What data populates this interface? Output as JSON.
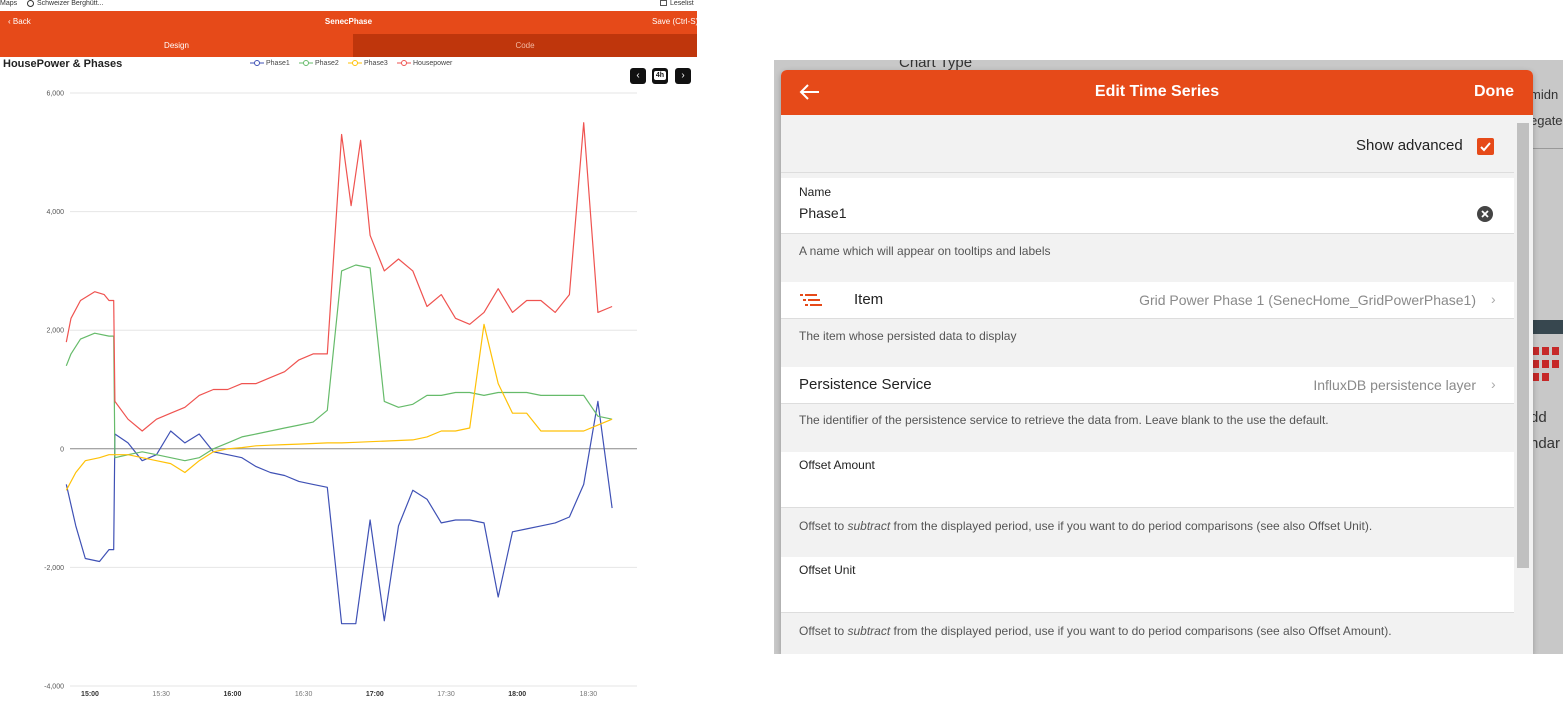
{
  "browser": {
    "bookmarks": [
      {
        "label": "Maps"
      },
      {
        "label": "Schweizer Berghütt..."
      }
    ],
    "reading_list": "Leselist"
  },
  "app": {
    "back_label": "Back",
    "title": "SenecPhase",
    "save_label": "Save (Ctrl-S)",
    "tabs": [
      {
        "label": "Design"
      },
      {
        "label": "Code"
      }
    ]
  },
  "chart_data": {
    "type": "line",
    "title": "HousePower & Phases",
    "xlabel": "",
    "ylabel": "",
    "ylim": [
      -4000,
      6000
    ],
    "yticks": [
      "6,000",
      "4,000",
      "2,000",
      "0",
      "-2,000",
      "-4,000"
    ],
    "xticks": [
      {
        "label": "15:00",
        "bold": true
      },
      {
        "label": "15:30",
        "bold": false
      },
      {
        "label": "16:00",
        "bold": true
      },
      {
        "label": "16:30",
        "bold": false
      },
      {
        "label": "17:00",
        "bold": true
      },
      {
        "label": "17:30",
        "bold": false
      },
      {
        "label": "18:00",
        "bold": true
      },
      {
        "label": "18:30",
        "bold": false
      }
    ],
    "x_unit": "minutes after 14:50",
    "grid": true,
    "legend_position": "top",
    "range_label": "4h",
    "series": [
      {
        "name": "Phase1",
        "color": "#3f51b5",
        "x": [
          0,
          4,
          8,
          14,
          18,
          20,
          20.5,
          26,
          32,
          38,
          44,
          50,
          56,
          62,
          68,
          74,
          80,
          86,
          92,
          98,
          104,
          110,
          116,
          122,
          128,
          134,
          140,
          146,
          152,
          158,
          164,
          170,
          176,
          182,
          188,
          194,
          200,
          206,
          212,
          218,
          224,
          230
        ],
        "y": [
          -600,
          -1300,
          -1850,
          -1900,
          -1700,
          -1700,
          250,
          100,
          -200,
          -100,
          300,
          100,
          250,
          -50,
          -100,
          -150,
          -300,
          -400,
          -450,
          -550,
          -600,
          -650,
          -2950,
          -2950,
          -1200,
          -2900,
          -1300,
          -700,
          -850,
          -1250,
          -1200,
          -1200,
          -1250,
          -2500,
          -1400,
          -1350,
          -1300,
          -1250,
          -1150,
          -600,
          800,
          -1000
        ]
      },
      {
        "name": "Phase2",
        "color": "#66bb6a",
        "x": [
          0,
          2,
          6,
          12,
          18,
          20,
          20.5,
          26,
          32,
          38,
          44,
          50,
          56,
          62,
          68,
          74,
          80,
          86,
          92,
          98,
          104,
          110,
          116,
          122,
          128,
          134,
          140,
          146,
          152,
          158,
          164,
          170,
          176,
          182,
          188,
          194,
          200,
          206,
          212,
          218,
          224,
          230
        ],
        "y": [
          1400,
          1600,
          1850,
          1950,
          1900,
          1900,
          -150,
          -100,
          -50,
          -100,
          -150,
          -200,
          -150,
          0,
          100,
          200,
          250,
          300,
          350,
          400,
          450,
          650,
          3000,
          3100,
          3050,
          800,
          700,
          750,
          900,
          900,
          950,
          950,
          900,
          950,
          950,
          950,
          900,
          900,
          900,
          900,
          550,
          500
        ]
      },
      {
        "name": "Phase3",
        "color": "#ffc107",
        "x": [
          0,
          4,
          8,
          14,
          18,
          20,
          20.5,
          26,
          32,
          38,
          44,
          50,
          56,
          62,
          68,
          74,
          80,
          86,
          92,
          98,
          104,
          110,
          116,
          122,
          128,
          134,
          140,
          146,
          152,
          158,
          164,
          170,
          176,
          182,
          188,
          194,
          200,
          206,
          212,
          218,
          224,
          230
        ],
        "y": [
          -700,
          -400,
          -200,
          -150,
          -100,
          -100,
          -100,
          -100,
          -150,
          -200,
          -250,
          -400,
          -200,
          -50,
          0,
          20,
          50,
          60,
          70,
          80,
          90,
          100,
          100,
          110,
          120,
          130,
          140,
          150,
          200,
          300,
          300,
          350,
          2100,
          1100,
          600,
          600,
          300,
          300,
          300,
          300,
          400,
          500
        ]
      },
      {
        "name": "Housepower",
        "color": "#ef5350",
        "x": [
          0,
          2,
          6,
          12,
          16,
          18,
          20,
          20.5,
          26,
          32,
          38,
          44,
          50,
          56,
          62,
          68,
          74,
          80,
          86,
          92,
          98,
          104,
          110,
          116,
          120,
          124,
          128,
          134,
          140,
          146,
          152,
          158,
          164,
          170,
          176,
          182,
          188,
          194,
          200,
          206,
          212,
          218,
          224,
          230
        ],
        "y": [
          1800,
          2200,
          2500,
          2650,
          2600,
          2500,
          2500,
          800,
          500,
          300,
          500,
          600,
          700,
          900,
          1000,
          1000,
          1100,
          1100,
          1200,
          1300,
          1500,
          1600,
          1600,
          5300,
          4100,
          5200,
          3600,
          3000,
          3200,
          3000,
          2400,
          2600,
          2200,
          2100,
          2300,
          2700,
          2300,
          2500,
          2500,
          2300,
          2600,
          5500,
          2300,
          2400
        ]
      }
    ]
  },
  "dialog": {
    "background_header": "Chart Type",
    "background_side": [
      "midn",
      "egate",
      "dd",
      "ndar"
    ],
    "title": "Edit Time Series",
    "done_label": "Done",
    "show_advanced": {
      "label": "Show advanced",
      "checked": true
    },
    "name_field": {
      "label": "Name",
      "value": "Phase1",
      "help": "A name which will appear on tooltips and labels"
    },
    "item": {
      "label": "Item",
      "value": "Grid Power Phase 1 (SenecHome_GridPowerPhase1)",
      "help": "The item whose persisted data to display"
    },
    "persistence": {
      "label": "Persistence Service",
      "value": "InfluxDB persistence layer",
      "help": "The identifier of the persistence service to retrieve the data from. Leave blank to the use the default."
    },
    "offset_amount": {
      "label": "Offset Amount",
      "value": "",
      "help_pre": "Offset to ",
      "help_em": "subtract",
      "help_post": " from the displayed period, use if you want to do period comparisons (see also Offset Unit)."
    },
    "offset_unit": {
      "label": "Offset Unit",
      "value": "",
      "help_pre": "Offset to ",
      "help_em": "subtract",
      "help_post": " from the displayed period, use if you want to do period comparisons (see also Offset Amount)."
    },
    "accent_color": "#e64a19"
  }
}
